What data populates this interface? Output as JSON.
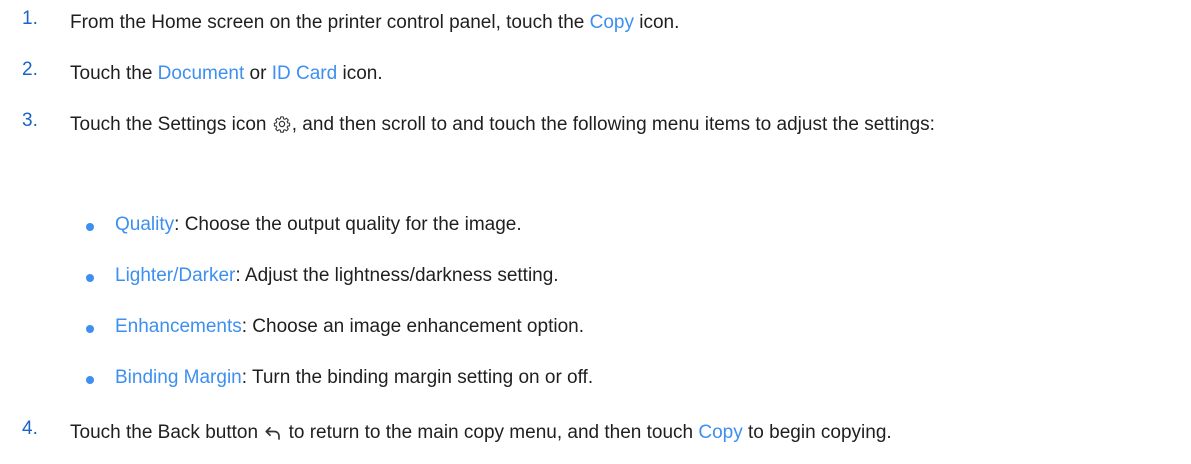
{
  "steps": [
    {
      "num": "1.",
      "before": "From the Home screen on the printer control panel, touch the ",
      "link": "Copy",
      "after": " icon."
    },
    {
      "num": "2.",
      "before": "Touch the ",
      "link1": "Document",
      "middle": " or ",
      "link2": "ID Card",
      "after": " icon."
    },
    {
      "num": "3.",
      "before": "Touch the Settings icon ",
      "icon": "gear-icon",
      "after": ", and then scroll to and touch the following menu items to adjust the settings:"
    },
    {
      "num": "4.",
      "before": "Touch the Back button ",
      "icon": "back-arrow-icon",
      "middle": " to return to the main copy menu, and then touch ",
      "link": "Copy",
      "after": " to begin copying."
    }
  ],
  "bullets": [
    {
      "link": "Quality",
      "text": ": Choose the output quality for the image."
    },
    {
      "link": "Lighter/Darker",
      "text": ": Adjust the lightness/darkness setting."
    },
    {
      "link": "Enhancements",
      "text": ": Choose an image enhancement option."
    },
    {
      "link": "Binding Margin",
      "text": ": Turn the binding margin setting on or off."
    }
  ],
  "colors": {
    "step_number": "#1a63c7",
    "link": "#3d8ff0",
    "text": "#1f1f1f"
  }
}
